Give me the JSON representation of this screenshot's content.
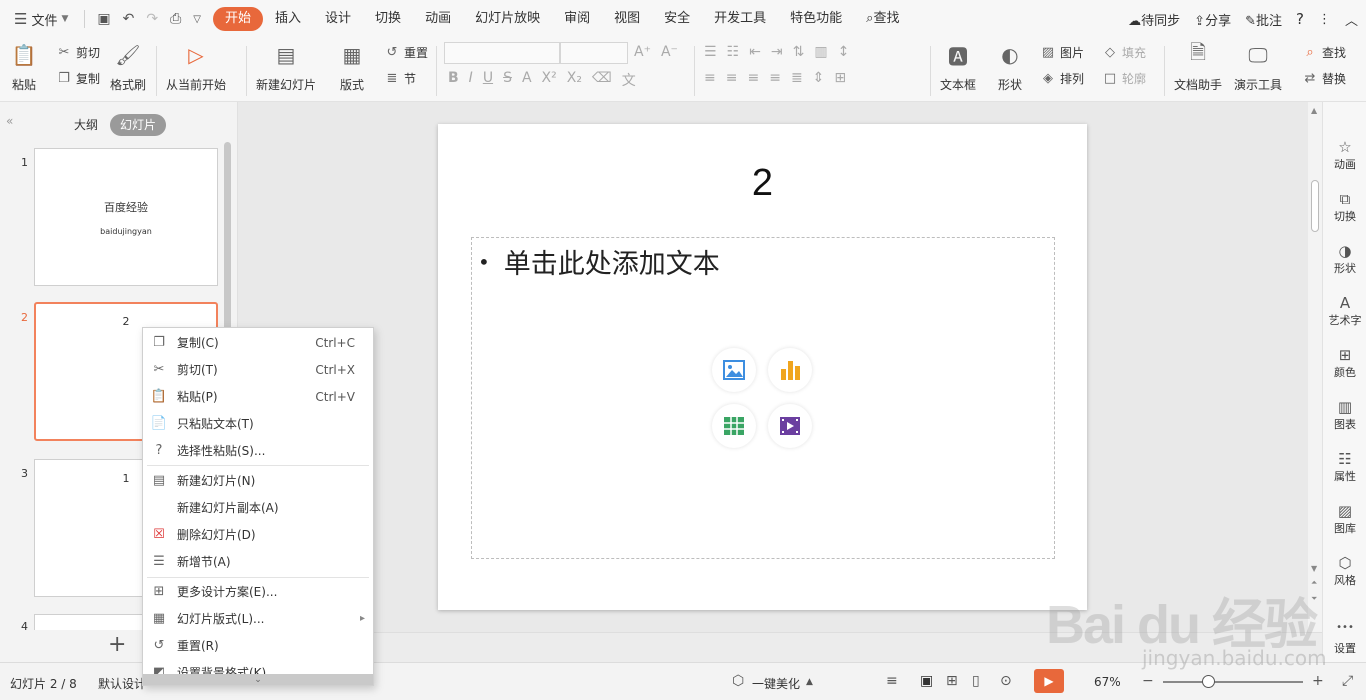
{
  "menubar": {
    "file": "文件",
    "tabs": [
      "开始",
      "插入",
      "设计",
      "切换",
      "动画",
      "幻灯片放映",
      "审阅",
      "视图",
      "安全",
      "开发工具",
      "特色功能"
    ],
    "search": "查找",
    "sync": "待同步",
    "share": "分享",
    "comment": "批注"
  },
  "ribbon": {
    "paste": "粘贴",
    "cut": "剪切",
    "copy": "复制",
    "format_painter": "格式刷",
    "from_current": "从当前开始",
    "new_slide": "新建幻灯片",
    "layout": "版式",
    "reset": "重置",
    "section": "节",
    "textbox": "文本框",
    "shape": "形状",
    "picture": "图片",
    "fill": "填充",
    "arrange": "排列",
    "outline": "轮廓",
    "doc_helper": "文档助手",
    "present_tools": "演示工具",
    "find": "查找",
    "replace": "替换"
  },
  "left_panel": {
    "tab_outline": "大纲",
    "tab_slides": "幻灯片",
    "thumbs": [
      {
        "num": "1",
        "title": "百度经验",
        "sub": "baidujingyan"
      },
      {
        "num": "2",
        "title": "2"
      },
      {
        "num": "3",
        "title": "1"
      },
      {
        "num": "4",
        "title": ""
      }
    ]
  },
  "slide": {
    "title": "2",
    "body": "单击此处添加文本"
  },
  "right_sidebar": [
    "动画",
    "切换",
    "形状",
    "艺术字",
    "颜色",
    "图表",
    "属性",
    "图库",
    "风格",
    "设置"
  ],
  "context_menu": {
    "items": [
      {
        "label": "复制(C)",
        "shortcut": "Ctrl+C"
      },
      {
        "label": "剪切(T)",
        "shortcut": "Ctrl+X"
      },
      {
        "label": "粘贴(P)",
        "shortcut": "Ctrl+V"
      },
      {
        "label": "只粘贴文本(T)",
        "shortcut": ""
      },
      {
        "label": "选择性粘贴(S)...",
        "shortcut": ""
      },
      {
        "label": "新建幻灯片(N)",
        "shortcut": ""
      },
      {
        "label": "新建幻灯片副本(A)",
        "shortcut": ""
      },
      {
        "label": "删除幻灯片(D)",
        "shortcut": ""
      },
      {
        "label": "新增节(A)",
        "shortcut": ""
      },
      {
        "label": "更多设计方案(E)...",
        "shortcut": ""
      },
      {
        "label": "幻灯片版式(L)...",
        "shortcut": ""
      },
      {
        "label": "重置(R)",
        "shortcut": ""
      },
      {
        "label": "设置背景格式(K)",
        "shortcut": ""
      }
    ]
  },
  "statusbar": {
    "slide_pos": "幻灯片 2 / 8",
    "theme": "默认设计",
    "beautify": "一键美化",
    "zoom": "67%"
  },
  "watermark": {
    "brand": "Bai du 经验",
    "url": "jingyan.baidu.com"
  },
  "colors": {
    "accent": "#e8683b",
    "selected_border": "#f2825c"
  }
}
